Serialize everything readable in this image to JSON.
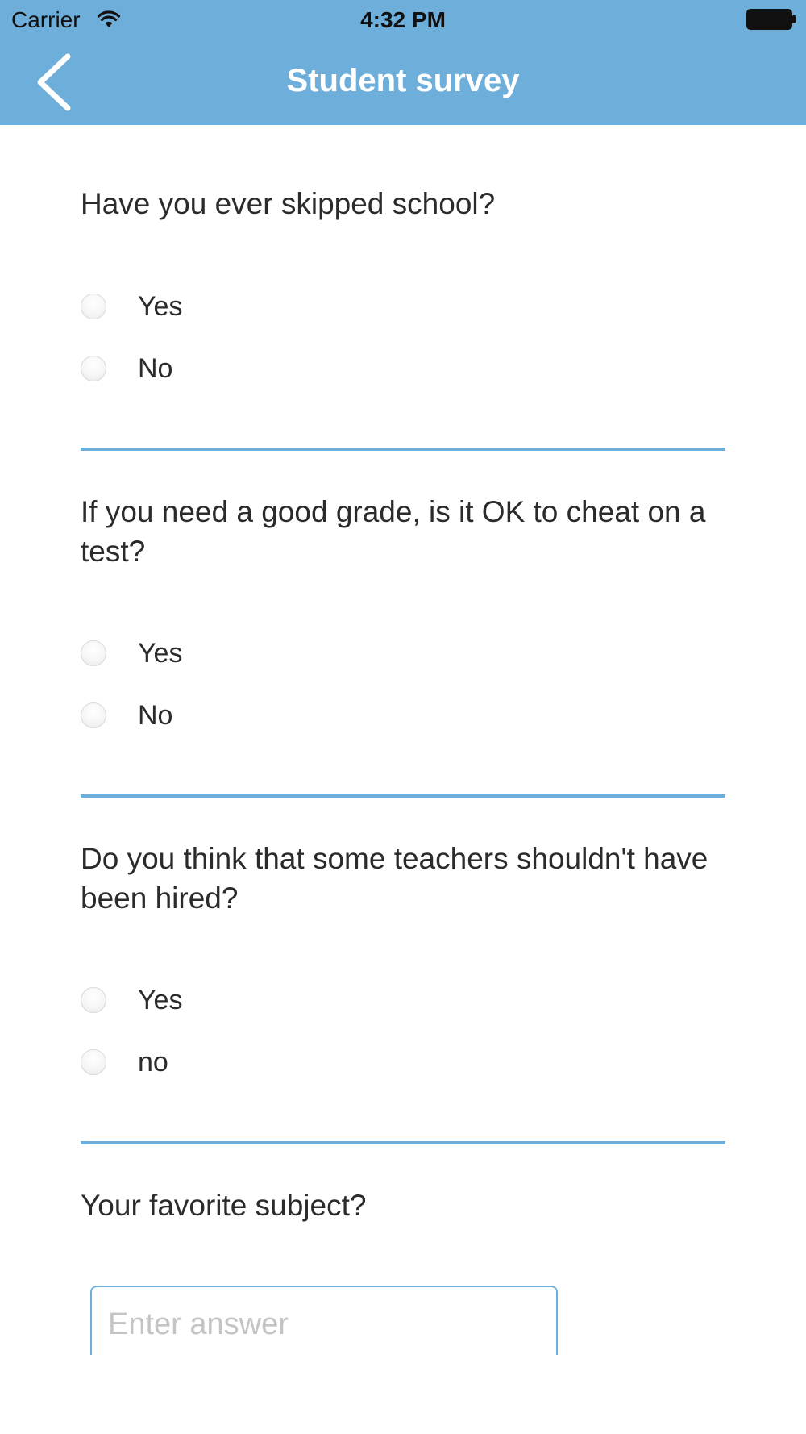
{
  "status_bar": {
    "carrier": "Carrier",
    "time": "4:32 PM",
    "wifi_icon": "wifi-icon",
    "battery_icon": "battery-icon"
  },
  "nav": {
    "title": "Student survey",
    "back_icon": "chevron-left-icon"
  },
  "colors": {
    "accent": "#6eaedb",
    "text": "#2b2b2b",
    "placeholder": "#c4c4c4"
  },
  "questions": [
    {
      "text": "Have you ever skipped school?",
      "type": "radio",
      "options": [
        "Yes",
        "No"
      ]
    },
    {
      "text": "If you need a good grade, is it OK to cheat on a test?",
      "type": "radio",
      "options": [
        "Yes",
        "No"
      ]
    },
    {
      "text": "Do you think that some teachers shouldn't have been hired?",
      "type": "radio",
      "options": [
        "Yes",
        "no"
      ]
    },
    {
      "text": "Your favorite subject?",
      "type": "text",
      "value": "",
      "placeholder": "Enter answer"
    }
  ]
}
